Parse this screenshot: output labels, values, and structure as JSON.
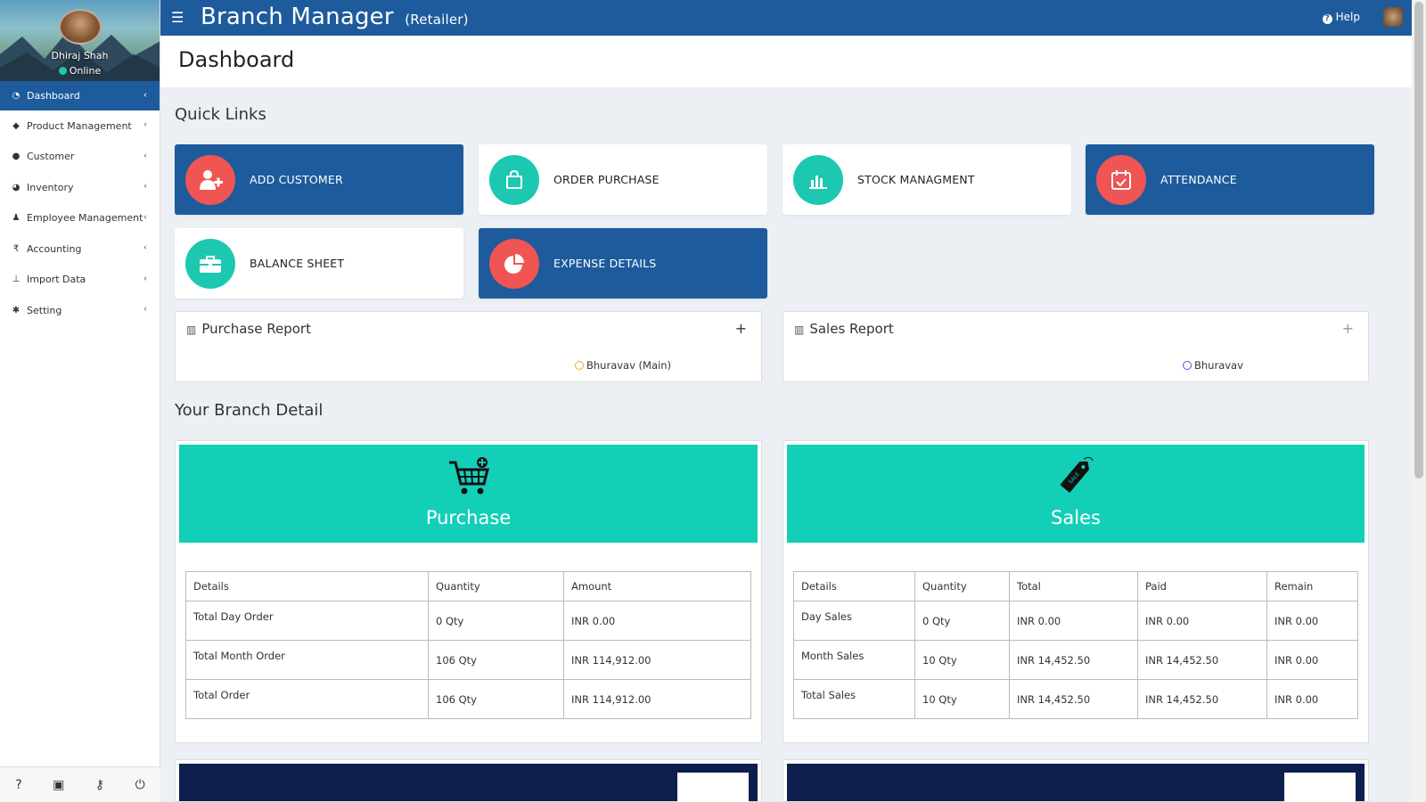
{
  "user": {
    "name": "Dhiraj Shah",
    "status": "Online"
  },
  "header": {
    "brand": "Branch Manager",
    "brand_sub": "(Retailer)",
    "help_label": "Help"
  },
  "sidebar": {
    "items": [
      {
        "label": "Dashboard",
        "icon": "dashboard-icon",
        "active": true
      },
      {
        "label": "Product Management",
        "icon": "cube-icon"
      },
      {
        "label": "Customer",
        "icon": "users-icon"
      },
      {
        "label": "Inventory",
        "icon": "pie-chart-icon"
      },
      {
        "label": "Employee Management",
        "icon": "person-icon"
      },
      {
        "label": "Accounting",
        "icon": "rupee-icon"
      },
      {
        "label": "Import Data",
        "icon": "sitemap-icon"
      },
      {
        "label": "Setting",
        "icon": "gear-icon"
      }
    ],
    "footer_icons": [
      "help-icon",
      "id-card-icon",
      "key-icon",
      "power-icon"
    ]
  },
  "page": {
    "title": "Dashboard"
  },
  "quick_links": {
    "title": "Quick Links",
    "items": [
      {
        "label": "ADD CUSTOMER",
        "style": "blue",
        "icon": "add-user-icon",
        "icon_color": "#f05453"
      },
      {
        "label": "ORDER PURCHASE",
        "style": "white",
        "icon": "shopping-bag-icon",
        "icon_color": "#1cc9b0"
      },
      {
        "label": "STOCK MANAGMENT",
        "style": "white",
        "icon": "bar-chart-icon",
        "icon_color": "#1cc9b0"
      },
      {
        "label": "ATTENDANCE",
        "style": "blue",
        "icon": "calendar-check-icon",
        "icon_color": "#f05453"
      },
      {
        "label": "BALANCE SHEET",
        "style": "white",
        "icon": "briefcase-icon",
        "icon_color": "#1cc9b0"
      },
      {
        "label": "EXPENSE DETAILS",
        "style": "blue",
        "icon": "pie-icon",
        "icon_color": "#f05453"
      }
    ]
  },
  "reports": {
    "purchase": {
      "title": "Purchase Report",
      "legend": "Bhuravav (Main)",
      "legend_color": "#f5a623"
    },
    "sales": {
      "title": "Sales Report",
      "legend": "Bhuravav",
      "legend_color": "#5b4fd6"
    }
  },
  "branch_detail": {
    "title": "Your Branch Detail",
    "purchase": {
      "title": "Purchase",
      "headers": [
        "Details",
        "Quantity",
        "Amount"
      ],
      "rows": [
        [
          "Total Day Order",
          "0 Qty",
          "INR 0.00"
        ],
        [
          "Total Month Order",
          "106 Qty",
          "INR 114,912.00"
        ],
        [
          "Total Order",
          "106 Qty",
          "INR 114,912.00"
        ]
      ]
    },
    "sales": {
      "title": "Sales",
      "headers": [
        "Details",
        "Quantity",
        "Total",
        "Paid",
        "Remain"
      ],
      "rows": [
        [
          "Day Sales",
          "0 Qty",
          "INR 0.00",
          "INR 0.00",
          "INR 0.00"
        ],
        [
          "Month Sales",
          "10 Qty",
          "INR 14,452.50",
          "INR 14,452.50",
          "INR 0.00"
        ],
        [
          "Total Sales",
          "10 Qty",
          "INR 14,452.50",
          "INR 14,452.50",
          "INR 0.00"
        ]
      ]
    }
  },
  "colors": {
    "primary": "#1e5b9c",
    "accent_red": "#f05453",
    "accent_teal": "#1cc9b0",
    "banner_teal": "#14cfb8",
    "navy": "#0c1f4d"
  }
}
